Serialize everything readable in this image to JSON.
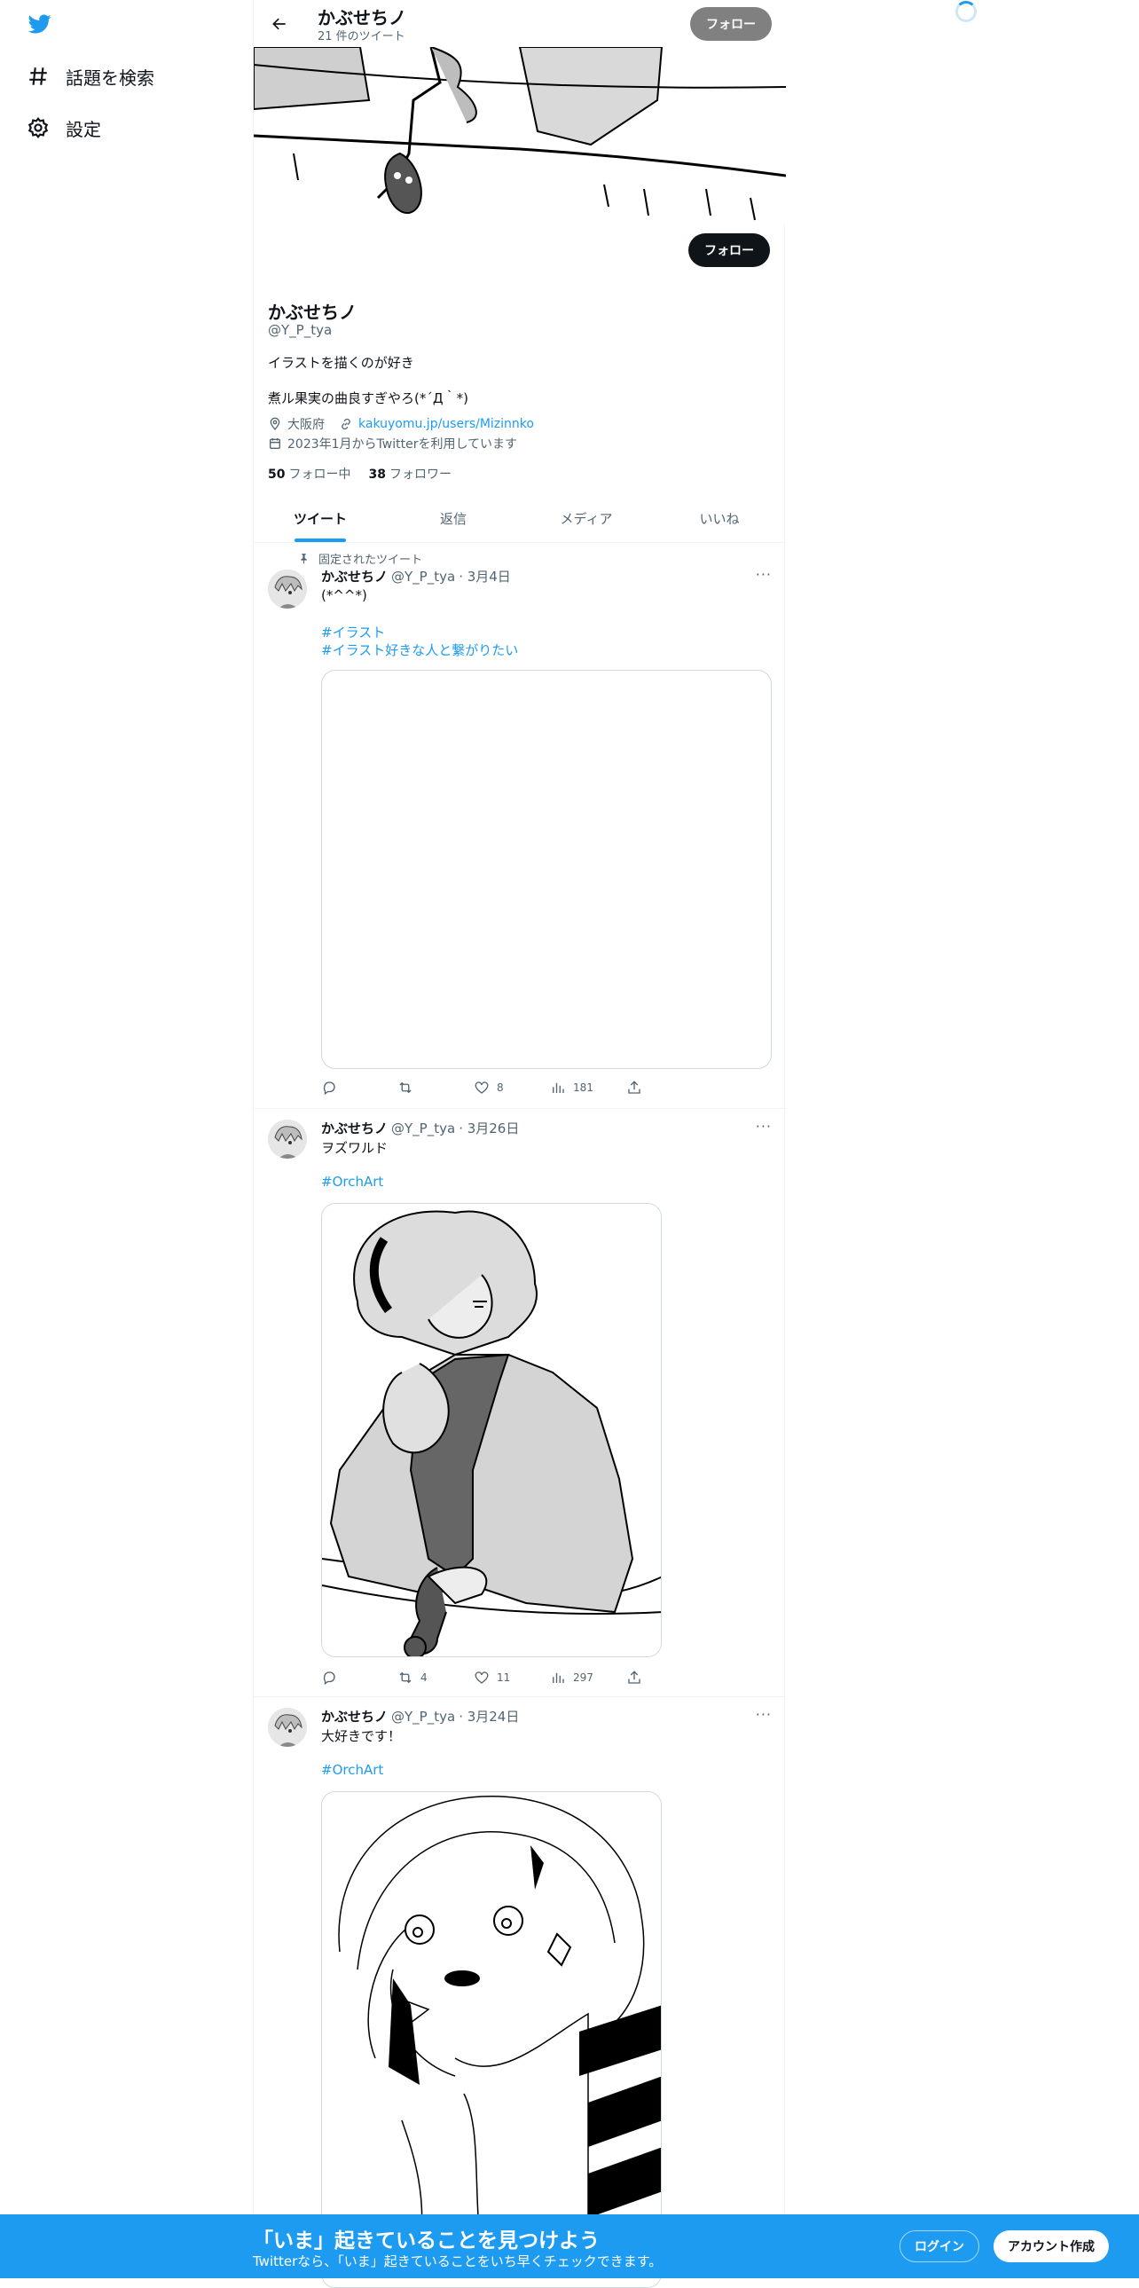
{
  "nav": {
    "explore_label": "話題を検索",
    "settings_label": "設定"
  },
  "header": {
    "name": "かぶせちノ",
    "tweet_count": "21 件のツイート",
    "follow_label": "フォロー"
  },
  "profile": {
    "follow_label": "フォロー",
    "name": "かぶせちノ",
    "handle": "@Y_P_tya",
    "bio_line1": "イラストを描くのが好き",
    "bio_line2": "煮ル果実の曲良すぎやろ(*´Д｀*)",
    "location": "大阪府",
    "link": "kakuyomu.jp/users/Mizinnko",
    "joined": "2023年1月からTwitterを利用しています",
    "following_count": "50",
    "following_label": "フォロー中",
    "followers_count": "38",
    "followers_label": "フォロワー"
  },
  "tabs": [
    {
      "label": "ツイート",
      "active": true
    },
    {
      "label": "返信",
      "active": false
    },
    {
      "label": "メディア",
      "active": false
    },
    {
      "label": "いいね",
      "active": false
    }
  ],
  "tweets": [
    {
      "pinned_label": "固定されたツイート",
      "name": "かぶせちノ",
      "handle": "@Y_P_tya",
      "date": "· 3月4日",
      "text": "(*^^*)",
      "hashtags": [
        "#イラスト",
        "#イラスト好きな人と繋がりたい"
      ],
      "replies": "",
      "retweets": "",
      "likes": "8",
      "views": "181"
    },
    {
      "name": "かぶせちノ",
      "handle": "@Y_P_tya",
      "date": "· 3月26日",
      "text": "ヲズワルド",
      "hashtags": [
        "#OrchArt"
      ],
      "replies": "",
      "retweets": "4",
      "likes": "11",
      "views": "297"
    },
    {
      "name": "かぶせちノ",
      "handle": "@Y_P_tya",
      "date": "· 3月24日",
      "text": "大好きです！",
      "hashtags": [
        "#OrchArt"
      ]
    }
  ],
  "bottom_bar": {
    "title": "「いま」起きていることを見つけよう",
    "subtitle": "Twitterなら、「いま」起きていることをいち早くチェックできます。",
    "login_label": "ログイン",
    "signup_label": "アカウント作成"
  },
  "colors": {
    "accent": "#1d9bf0",
    "text": "#0f1419",
    "muted": "#536471",
    "border": "#eff3f4"
  },
  "icons": [
    "twitter-bird-icon",
    "hashtag-icon",
    "gear-icon",
    "back-arrow-icon",
    "location-icon",
    "link-icon",
    "calendar-icon",
    "pin-icon",
    "reply-icon",
    "retweet-icon",
    "like-icon",
    "views-icon",
    "share-icon",
    "more-icon"
  ]
}
